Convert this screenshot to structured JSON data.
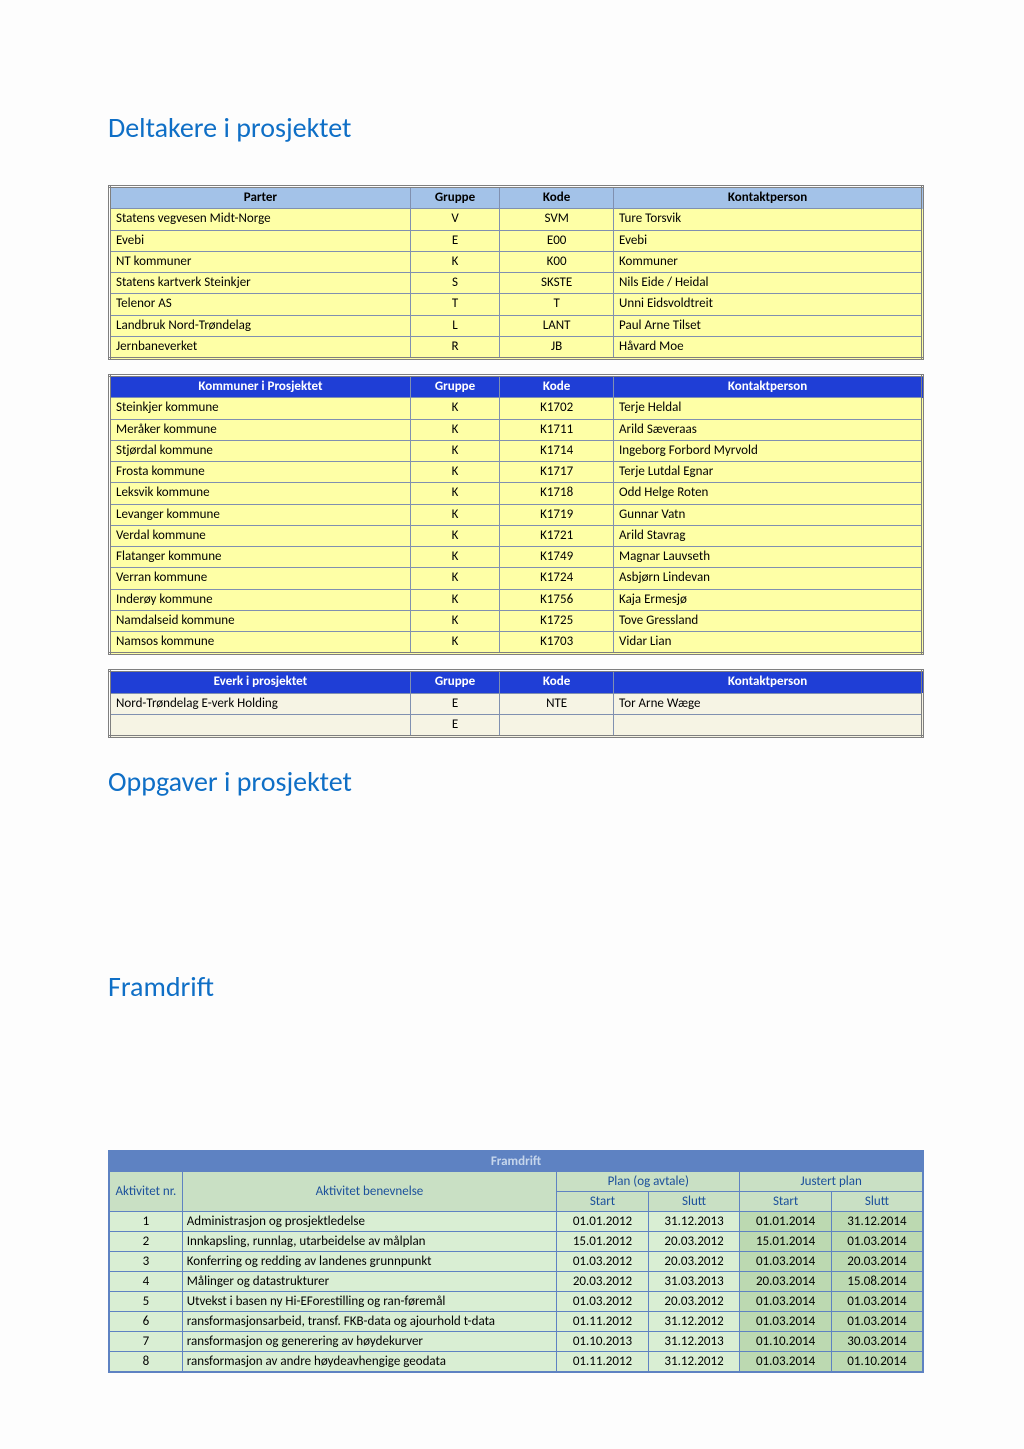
{
  "sections": {
    "deltakere": "Deltakere i prosjektet",
    "oppgaver": "Oppgaver i prosjektet",
    "framdrift": "Framdrift"
  },
  "table1": {
    "headers": {
      "parter": "Parter",
      "gruppe": "Gruppe",
      "kode": "Kode",
      "kontakt": "Kontaktperson"
    },
    "rows": [
      {
        "parter": "Statens vegvesen Midt-Norge",
        "gruppe": "V",
        "kode": "SVM",
        "kontakt": "Ture Torsvik"
      },
      {
        "parter": "Evebi",
        "gruppe": "E",
        "kode": "E00",
        "kontakt": "Evebi"
      },
      {
        "parter": "NT kommuner",
        "gruppe": "K",
        "kode": "K00",
        "kontakt": "Kommuner"
      },
      {
        "parter": "Statens kartverk Steinkjer",
        "gruppe": "S",
        "kode": "SKSTE",
        "kontakt": "Nils Eide / Heidal"
      },
      {
        "parter": "Telenor AS",
        "gruppe": "T",
        "kode": "T",
        "kontakt": "Unni Eidsvoldtreit"
      },
      {
        "parter": "Landbruk Nord-Trøndelag",
        "gruppe": "L",
        "kode": "LANT",
        "kontakt": "Paul Arne Tilset"
      },
      {
        "parter": "Jernbaneverket",
        "gruppe": "R",
        "kode": "JB",
        "kontakt": "Håvard Moe"
      }
    ]
  },
  "table2": {
    "headers": {
      "parter": "Kommuner i Prosjektet",
      "gruppe": "Gruppe",
      "kode": "Kode",
      "kontakt": "Kontaktperson"
    },
    "rows": [
      {
        "parter": "Steinkjer kommune",
        "gruppe": "K",
        "kode": "K1702",
        "kontakt": "Terje Heldal"
      },
      {
        "parter": "Meråker kommune",
        "gruppe": "K",
        "kode": "K1711",
        "kontakt": "Arild Sæveraas"
      },
      {
        "parter": "Stjørdal kommune",
        "gruppe": "K",
        "kode": "K1714",
        "kontakt": "Ingeborg Forbord Myrvold"
      },
      {
        "parter": "Frosta kommune",
        "gruppe": "K",
        "kode": "K1717",
        "kontakt": "Terje Lutdal Egnar"
      },
      {
        "parter": "Leksvik kommune",
        "gruppe": "K",
        "kode": "K1718",
        "kontakt": "Odd Helge Roten"
      },
      {
        "parter": "Levanger kommune",
        "gruppe": "K",
        "kode": "K1719",
        "kontakt": "Gunnar Vatn"
      },
      {
        "parter": "Verdal kommune",
        "gruppe": "K",
        "kode": "K1721",
        "kontakt": "Arild Stavrag"
      },
      {
        "parter": "Flatanger kommune",
        "gruppe": "K",
        "kode": "K1749",
        "kontakt": "Magnar Lauvseth"
      },
      {
        "parter": "Verran kommune",
        "gruppe": "K",
        "kode": "K1724",
        "kontakt": "Asbjørn Lindevan"
      },
      {
        "parter": "Inderøy kommune",
        "gruppe": "K",
        "kode": "K1756",
        "kontakt": "Kaja Ermesjø"
      },
      {
        "parter": "Namdalseid kommune",
        "gruppe": "K",
        "kode": "K1725",
        "kontakt": "Tove Gressland"
      },
      {
        "parter": "Namsos kommune",
        "gruppe": "K",
        "kode": "K1703",
        "kontakt": "Vidar Lian"
      }
    ]
  },
  "table3": {
    "headers": {
      "parter": "Everk i prosjektet",
      "gruppe": "Gruppe",
      "kode": "Kode",
      "kontakt": "Kontaktperson"
    },
    "rows": [
      {
        "parter": "Nord-Trøndelag E-verk Holding",
        "gruppe": "E",
        "kode": "NTE",
        "kontakt": "Tor Arne Wæge"
      },
      {
        "parter": "",
        "gruppe": "E",
        "kode": "",
        "kontakt": ""
      }
    ]
  },
  "framdrift": {
    "title": "Framdrift",
    "head": {
      "nr": "Aktivitet\nnr.",
      "act": "Aktivitet\nbenevnelse",
      "plan": "Plan (og avtale)",
      "justert": "Justert plan",
      "start": "Start",
      "slutt": "Slutt"
    },
    "rows": [
      {
        "nr": "1",
        "act": "Administrasjon og prosjektledelse",
        "ps": "01.01.2012",
        "psl": "31.12.2013",
        "js": "01.01.2014",
        "jsl": "31.12.2014"
      },
      {
        "nr": "2",
        "act": "Innkapsling, runnlag, utarbeidelse av målplan",
        "ps": "15.01.2012",
        "psl": "20.03.2012",
        "js": "15.01.2014",
        "jsl": "01.03.2014"
      },
      {
        "nr": "3",
        "act": "Konferring og redding av landenes grunnpunkt",
        "ps": "01.03.2012",
        "psl": "20.03.2012",
        "js": "01.03.2014",
        "jsl": "20.03.2014"
      },
      {
        "nr": "4",
        "act": "Målinger og datastrukturer",
        "ps": "20.03.2012",
        "psl": "31.03.2013",
        "js": "20.03.2014",
        "jsl": "15.08.2014"
      },
      {
        "nr": "5",
        "act": "Utvekst i basen  ny Hi-EForestilling og ran-føremål",
        "ps": "01.03.2012",
        "psl": "20.03.2012",
        "js": "01.03.2014",
        "jsl": "01.03.2014"
      },
      {
        "nr": "6",
        "act": "ransformasjonsarbeid, transf. FKB-data og ajourhold t-data",
        "ps": "01.11.2012",
        "psl": "31.12.2012",
        "js": "01.03.2014",
        "jsl": "01.03.2014"
      },
      {
        "nr": "7",
        "act": "ransformasjon og generering av høydekurver",
        "ps": "01.10.2013",
        "psl": "31.12.2013",
        "js": "01.10.2014",
        "jsl": "30.03.2014"
      },
      {
        "nr": "8",
        "act": "ransformasjon av andre høydeavhengige geodata",
        "ps": "01.11.2012",
        "psl": "31.12.2012",
        "js": "01.03.2014",
        "jsl": "01.10.2014"
      }
    ]
  }
}
